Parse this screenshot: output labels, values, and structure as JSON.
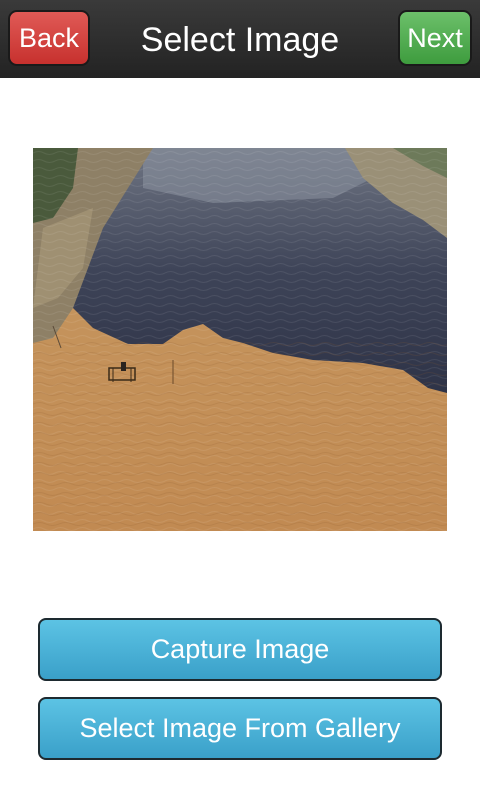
{
  "nav": {
    "title": "Select Image",
    "back_label": "Back",
    "next_label": "Next",
    "back_color": "#d9443f",
    "next_color": "#52b152"
  },
  "preview": {
    "icon": "photo-preview"
  },
  "actions": {
    "capture_label": "Capture Image",
    "gallery_label": "Select Image From Gallery",
    "button_color": "#4ab3d8"
  }
}
